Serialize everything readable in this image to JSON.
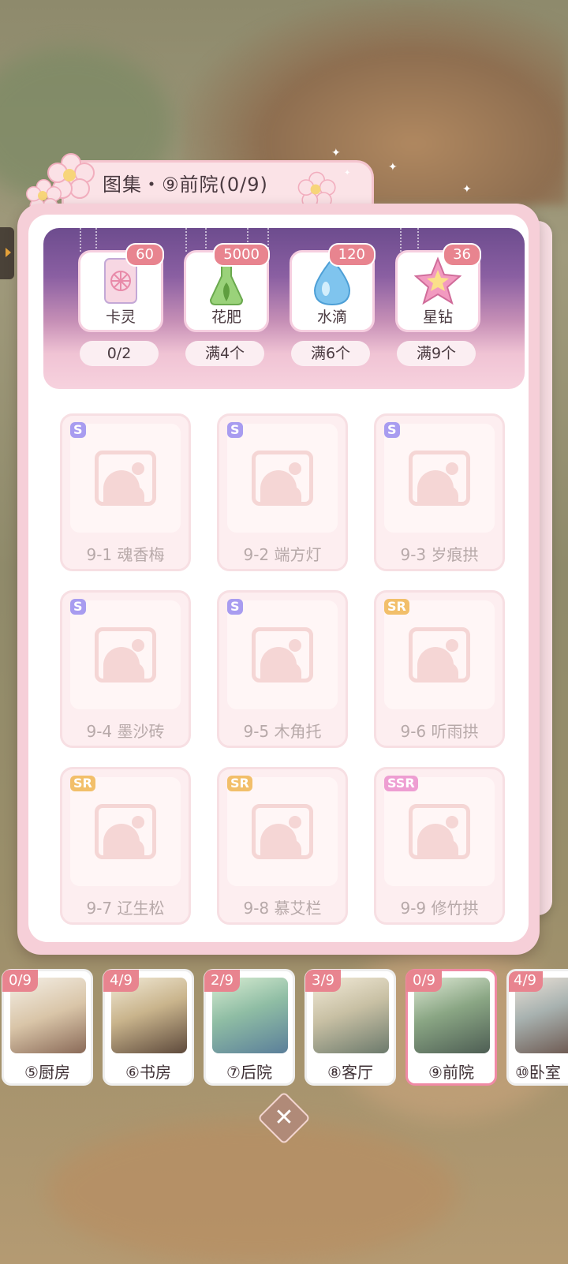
{
  "title": "图集・⑨前院(0/9)",
  "rewards": [
    {
      "label": "卡灵",
      "badge": "60",
      "goal": "0/2",
      "icon": "card-icon"
    },
    {
      "label": "花肥",
      "badge": "5000",
      "goal": "满4个",
      "icon": "fertilizer-flask-icon"
    },
    {
      "label": "水滴",
      "badge": "120",
      "goal": "满6个",
      "icon": "water-drop-icon"
    },
    {
      "label": "星钻",
      "badge": "36",
      "goal": "满9个",
      "icon": "star-diamond-icon"
    }
  ],
  "items": [
    {
      "label": "9-1 魂香梅",
      "rarity": "S"
    },
    {
      "label": "9-2 端方灯",
      "rarity": "S"
    },
    {
      "label": "9-3 岁痕拱",
      "rarity": "S"
    },
    {
      "label": "9-4 墨沙砖",
      "rarity": "S"
    },
    {
      "label": "9-5 木角托",
      "rarity": "S"
    },
    {
      "label": "9-6 听雨拱",
      "rarity": "SR"
    },
    {
      "label": "9-7 辽生松",
      "rarity": "SR"
    },
    {
      "label": "9-8 慕艾栏",
      "rarity": "SR"
    },
    {
      "label": "9-9 修竹拱",
      "rarity": "SSR"
    }
  ],
  "rooms": [
    {
      "label": "⑤厨房",
      "count": "0/9",
      "active": false
    },
    {
      "label": "⑥书房",
      "count": "4/9",
      "active": false
    },
    {
      "label": "⑦后院",
      "count": "2/9",
      "active": false
    },
    {
      "label": "⑧客厅",
      "count": "3/9",
      "active": false
    },
    {
      "label": "⑨前院",
      "count": "0/9",
      "active": true
    },
    {
      "label": "⑩卧室",
      "count": "4/9",
      "active": false
    }
  ],
  "colors": {
    "accent": "#e8848f",
    "rarity_s": "#a89cf0",
    "rarity_sr": "#f2bf6a",
    "rarity_ssr": "#ee9ed2"
  }
}
